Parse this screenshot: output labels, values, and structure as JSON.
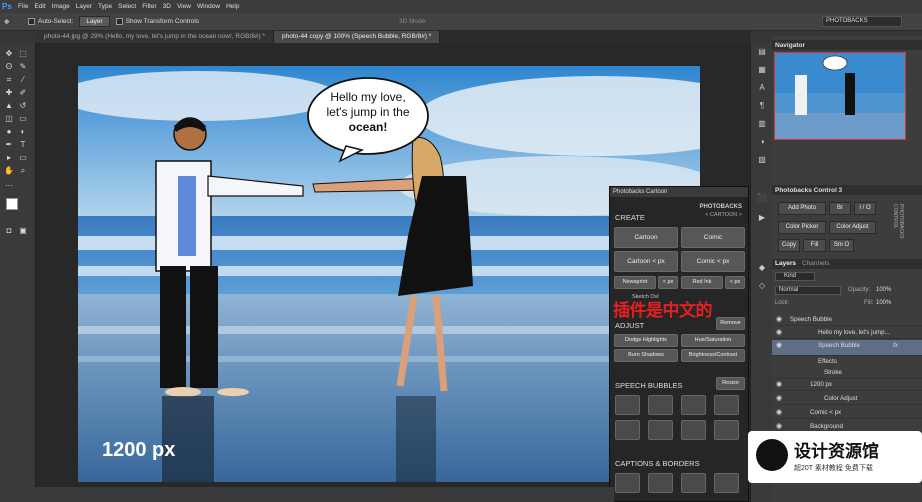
{
  "menubar": {
    "logo": "Ps",
    "items": [
      "File",
      "Edit",
      "Image",
      "Layer",
      "Type",
      "Select",
      "Filter",
      "3D",
      "View",
      "Window",
      "Help"
    ]
  },
  "options": {
    "auto_select": "Auto-Select:",
    "target": "Layer",
    "show_transform": "Show Transform Controls",
    "mode_3d": "3D Mode:",
    "workspace": "PHOTOBACKS"
  },
  "tabs": [
    "photo-44.jpg @ 29% (Hello, my love, let's jump in the ocean now!, RGB/8#) *",
    "photo-44 copy @ 100% (Speech Bubble, RGB/8#) *"
  ],
  "canvas": {
    "bubble_lines": [
      "Hello my love,",
      "let's jump in the",
      "ocean!"
    ],
    "size_label": "1200 px"
  },
  "navigator": {
    "title": "Navigator"
  },
  "control": {
    "title": "Photobacks Control 3",
    "buttons": [
      "Add Photo",
      "Br",
      "I / O",
      "Color Picker",
      "Color Adjust",
      "Copy",
      "Fill",
      "Sm O"
    ],
    "side_label": "PHOTOBACKS CONTROL"
  },
  "layers": {
    "tabs": [
      "Layers",
      "Channels"
    ],
    "kind": "Kind",
    "blend": "Normal",
    "opacity_label": "Opacity:",
    "opacity": "100%",
    "lock_label": "Lock:",
    "fill_label": "Fill:",
    "fill": "100%",
    "items": [
      {
        "name": "Speech Bubble"
      },
      {
        "name": "Hello my love, let's jump..."
      },
      {
        "name": "Speech Bubble",
        "fx": "fx"
      },
      {
        "name": "Effects"
      },
      {
        "name": "Stroke"
      },
      {
        "name": "1200 px"
      },
      {
        "name": "Color Adjust"
      },
      {
        "name": "Comic < px"
      },
      {
        "name": "Background"
      }
    ]
  },
  "cartoon": {
    "title": "Photobacks Cartoon",
    "brand": "PHOTOBACKS",
    "brand_sub": "< CARTOON >",
    "create": "CREATE",
    "buttons": {
      "cartoon": "Cartoon",
      "comic": "Comic",
      "cartoon_px": "Cartoon < px",
      "comic_px": "Comic < px",
      "newsprint": "Newsprint",
      "lt_px": "< px",
      "red_ink": "Red Ink",
      "lt": "< px",
      "sketch": "Sketch Ovl"
    },
    "adjust": "ADJUST",
    "remove": "Remove",
    "adj_buttons": [
      "Dodge Highlights",
      "Hue/Saturation",
      "Burn Shadows",
      "Brightness/Contrast"
    ],
    "bubbles": "SPEECH BUBBLES",
    "resize": "Resize",
    "captions": "CAPTIONS & BORDERS"
  },
  "overlay_cn": "插件是中文的",
  "watermark": {
    "title": "设计资源馆",
    "sub": "超20T 素材教程 免费下载"
  },
  "colors": {
    "accent": "#3ba0ff",
    "selected": "#5d6e86",
    "red": "#e52020"
  }
}
